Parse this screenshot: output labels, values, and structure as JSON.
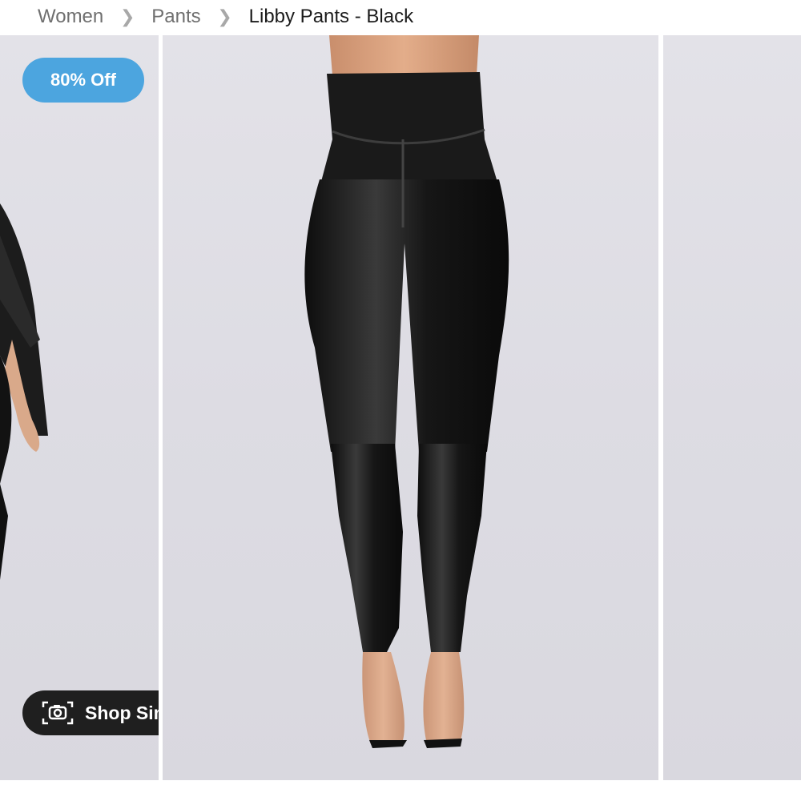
{
  "breadcrumb": {
    "items": [
      "Women",
      "Pants"
    ],
    "current": "Libby Pants - Black",
    "separator_icon": "chevron-right-icon"
  },
  "product": {
    "discount_badge": "80% Off",
    "shop_similar_label": "Shop Similar",
    "shop_similar_icon": "camera-scan-icon"
  },
  "colors": {
    "badge": "#4ca5df",
    "shop_similar_bg": "#1f1f1f",
    "image_bg": "#dddce3"
  }
}
